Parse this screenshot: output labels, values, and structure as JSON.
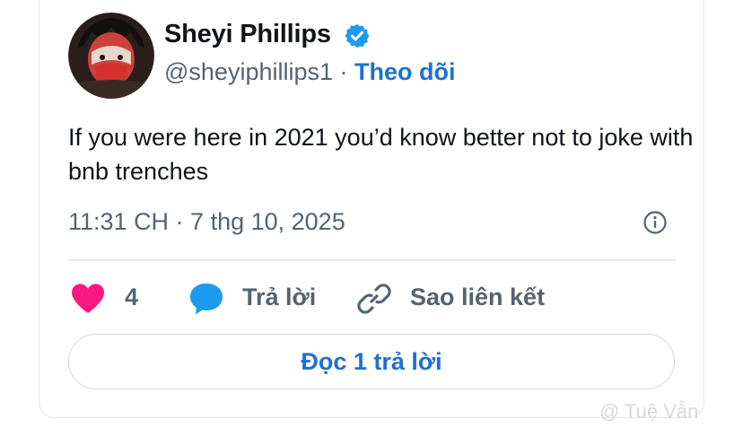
{
  "user": {
    "name": "Sheyi Phillips",
    "handle": "@sheyiphillips1",
    "separator": "·",
    "follow_label": "Theo dõi",
    "verified_icon": "verified-badge-icon",
    "verified_color": "#1d9bf0"
  },
  "post": {
    "text": "If you were here in 2021 you’d know better not to joke with bnb trenches",
    "timestamp": "11:31 CH · 7 thg 10, 2025"
  },
  "actions": {
    "like_count": "4",
    "like_icon": "heart-icon",
    "like_color": "#f91880",
    "reply_label": "Trả lời",
    "reply_icon": "speech-bubble-icon",
    "reply_color": "#1d9bf0",
    "copy_link_label": "Sao liên kết",
    "copy_link_icon": "link-icon"
  },
  "read_replies_label": "Đọc 1 trả lời",
  "watermark": "@ Tuệ Vẫn"
}
